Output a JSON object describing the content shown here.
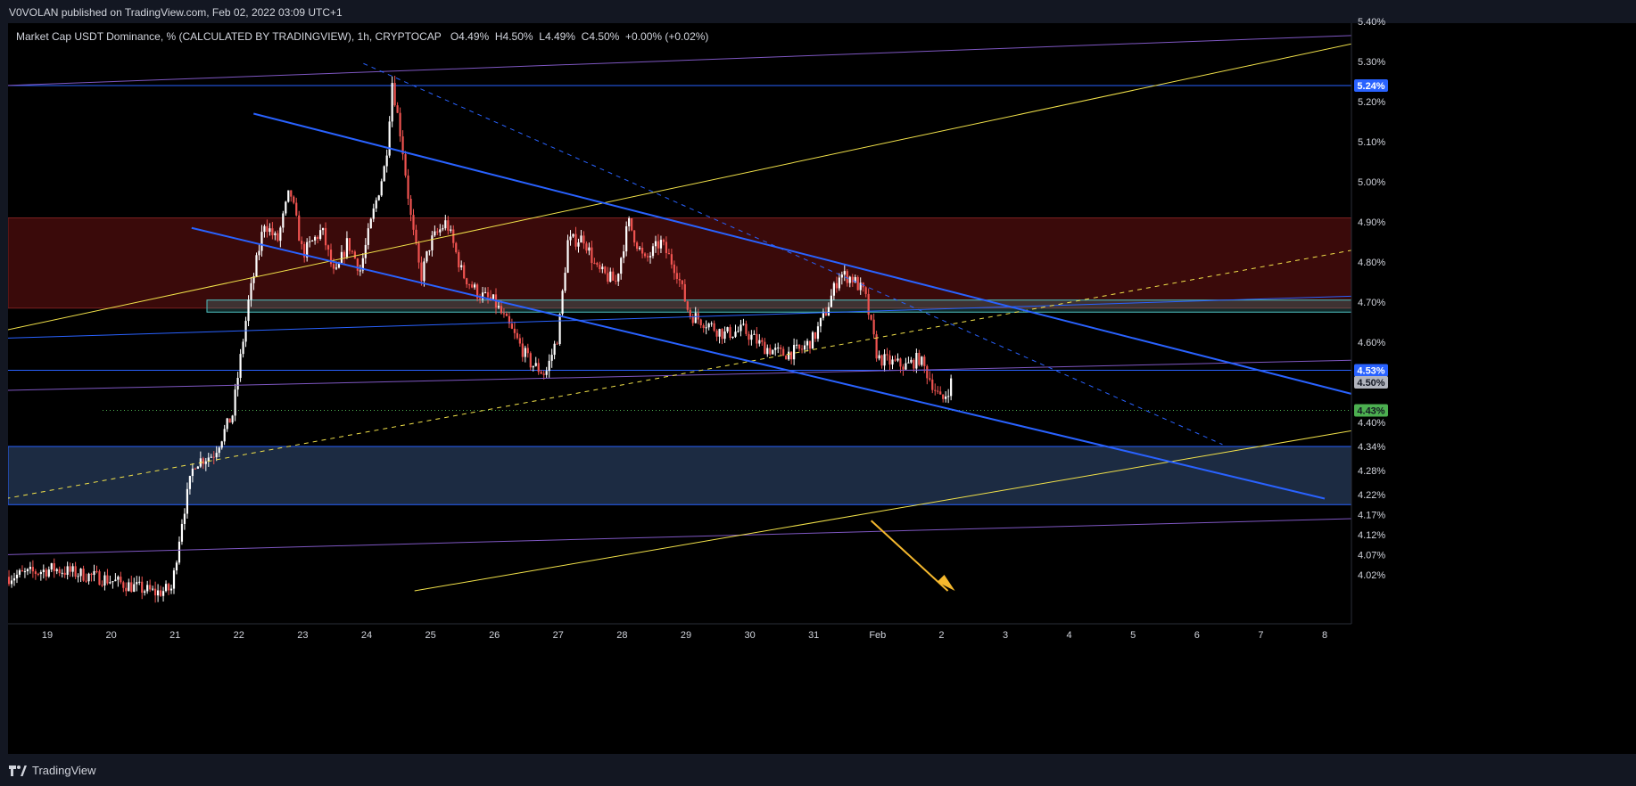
{
  "header": {
    "published": "V0VOLAN published on TradingView.com, Feb 02, 2022 03:09 UTC+1"
  },
  "legend": {
    "symbol": "Market Cap USDT Dominance, % (CALCULATED BY TRADINGVIEW), 1h, CRYPTOCAP",
    "o_label": "O",
    "o_value": "4.49%",
    "h_label": "H",
    "h_value": "4.50%",
    "l_label": "L",
    "l_value": "4.49%",
    "c_label": "C",
    "c_value": "4.50%",
    "change": "+0.00% (+0.02%)"
  },
  "footer": {
    "brand": "TradingView"
  },
  "colors": {
    "background": "#000000",
    "frame": "#131722",
    "up": "#ffffff",
    "down": "#ef5350",
    "resistance_zone": "#3a0a0a",
    "support_zone": "#1c2b42",
    "channel": "#2962ff",
    "yellow": "#f2e24a",
    "purple": "#7e57c2",
    "teal_box": "#4fc3c3"
  },
  "chart_data": {
    "type": "candlestick",
    "interval": "1h",
    "y_unit": "%",
    "ylim": [
      3.98,
      5.42
    ],
    "y_ticks": [
      "4.02%",
      "4.07%",
      "4.12%",
      "4.17%",
      "4.22%",
      "4.28%",
      "4.34%",
      "4.40%",
      "4.60%",
      "4.70%",
      "4.80%",
      "4.90%",
      "5.00%",
      "5.10%",
      "5.20%",
      "5.30%",
      "5.40%"
    ],
    "y_tick_values": [
      4.02,
      4.07,
      4.12,
      4.17,
      4.22,
      4.28,
      4.34,
      4.4,
      4.6,
      4.7,
      4.8,
      4.9,
      5.0,
      5.1,
      5.2,
      5.3,
      5.4
    ],
    "x_ticks": [
      "19",
      "20",
      "21",
      "22",
      "23",
      "24",
      "25",
      "26",
      "27",
      "28",
      "29",
      "30",
      "31",
      "Feb",
      "2",
      "3",
      "4",
      "5",
      "6",
      "7",
      "8"
    ],
    "x_tick_days": [
      0,
      1,
      2,
      3,
      4,
      5,
      6,
      7,
      8,
      9,
      10,
      11,
      12,
      13,
      14,
      15,
      16,
      17,
      18,
      19,
      20
    ],
    "price_labels": [
      {
        "text": "5.24%",
        "value": 5.24,
        "color": "#2962ff",
        "text_color": "#ffffff"
      },
      {
        "text": "4.53%",
        "value": 4.53,
        "color": "#2962ff",
        "text_color": "#ffffff"
      },
      {
        "text": "4.50%",
        "value": 4.5,
        "color": "#b2b5be",
        "text_color": "#131722"
      },
      {
        "text": "4.43%",
        "value": 4.43,
        "color": "#4caf50",
        "text_color": "#131722"
      }
    ],
    "zones": [
      {
        "name": "resistance",
        "from": 4.685,
        "to": 4.91
      },
      {
        "name": "support",
        "from": 4.195,
        "to": 4.34
      },
      {
        "name": "box",
        "from": 4.675,
        "to": 4.705,
        "x0": 2.5,
        "x1": 20.45
      }
    ],
    "horizontal_lines": [
      {
        "value": 5.24,
        "color": "#2962ff"
      },
      {
        "value": 4.53,
        "color": "#2962ff"
      },
      {
        "value": 4.43,
        "color": "#4caf50",
        "dotted": true
      }
    ],
    "trend_lines": [
      {
        "x0": -0.65,
        "y0": 5.24,
        "x1": 20.45,
        "y1": 5.365,
        "color": "#7e57c2"
      },
      {
        "x0": -0.65,
        "y0": 4.48,
        "x1": 20.45,
        "y1": 4.555,
        "color": "#7e57c2"
      },
      {
        "x0": -0.65,
        "y0": 4.07,
        "x1": 20.45,
        "y1": 4.16,
        "color": "#7e57c2"
      },
      {
        "x0": -0.65,
        "y0": 4.61,
        "x1": 20.45,
        "y1": 4.715,
        "color": "#2962ff"
      },
      {
        "x0": -0.65,
        "y0": 4.63,
        "x1": 20.45,
        "y1": 5.345,
        "color": "#f2e24a"
      },
      {
        "x0": 5.75,
        "y0": 3.98,
        "x1": 20.45,
        "y1": 4.38,
        "color": "#f2e24a"
      },
      {
        "x0": -0.65,
        "y0": 4.21,
        "x1": 20.45,
        "y1": 4.83,
        "color": "#f2e24a",
        "dashed": true
      },
      {
        "x0": 3.23,
        "y0": 5.17,
        "x1": 20.45,
        "y1": 4.47,
        "color": "#2962ff",
        "width": 2
      },
      {
        "x0": 2.26,
        "y0": 4.885,
        "x1": 20.0,
        "y1": 4.21,
        "color": "#2962ff",
        "width": 2
      },
      {
        "x0": 4.95,
        "y0": 5.295,
        "x1": 18.4,
        "y1": 4.345,
        "color": "#2962ff",
        "dashed": true
      }
    ],
    "arrow": {
      "x0": 12.9,
      "y0": 4.155,
      "x1": 14.1,
      "y1": 3.98,
      "color": "#f5b82e"
    },
    "anchors": [
      [
        -0.6,
        4.015
      ],
      [
        0.1,
        4.035
      ],
      [
        0.9,
        4.01
      ],
      [
        1.7,
        3.975
      ],
      [
        1.95,
        3.985
      ],
      [
        2.1,
        4.15
      ],
      [
        2.3,
        4.3
      ],
      [
        2.6,
        4.32
      ],
      [
        2.9,
        4.42
      ],
      [
        3.15,
        4.7
      ],
      [
        3.4,
        4.9
      ],
      [
        3.6,
        4.85
      ],
      [
        3.8,
        4.98
      ],
      [
        4.0,
        4.82
      ],
      [
        4.3,
        4.88
      ],
      [
        4.5,
        4.76
      ],
      [
        4.7,
        4.85
      ],
      [
        4.9,
        4.78
      ],
      [
        5.1,
        4.92
      ],
      [
        5.3,
        5.05
      ],
      [
        5.4,
        5.25
      ],
      [
        5.55,
        5.1
      ],
      [
        5.7,
        4.9
      ],
      [
        5.85,
        4.76
      ],
      [
        6.0,
        4.85
      ],
      [
        6.25,
        4.9
      ],
      [
        6.5,
        4.77
      ],
      [
        6.75,
        4.72
      ],
      [
        7.0,
        4.7
      ],
      [
        7.3,
        4.62
      ],
      [
        7.55,
        4.55
      ],
      [
        7.8,
        4.52
      ],
      [
        8.0,
        4.62
      ],
      [
        8.15,
        4.85
      ],
      [
        8.4,
        4.86
      ],
      [
        8.6,
        4.78
      ],
      [
        8.9,
        4.75
      ],
      [
        9.1,
        4.9
      ],
      [
        9.35,
        4.8
      ],
      [
        9.6,
        4.85
      ],
      [
        9.85,
        4.78
      ],
      [
        10.05,
        4.67
      ],
      [
        10.3,
        4.65
      ],
      [
        10.6,
        4.62
      ],
      [
        10.9,
        4.63
      ],
      [
        11.2,
        4.59
      ],
      [
        11.5,
        4.57
      ],
      [
        11.8,
        4.58
      ],
      [
        12.0,
        4.61
      ],
      [
        12.2,
        4.68
      ],
      [
        12.4,
        4.77
      ],
      [
        12.6,
        4.76
      ],
      [
        12.8,
        4.72
      ],
      [
        13.0,
        4.56
      ],
      [
        13.2,
        4.55
      ],
      [
        13.45,
        4.54
      ],
      [
        13.65,
        4.56
      ],
      [
        13.85,
        4.5
      ],
      [
        14.0,
        4.45
      ],
      [
        14.1,
        4.48
      ],
      [
        14.15,
        4.5
      ]
    ]
  }
}
